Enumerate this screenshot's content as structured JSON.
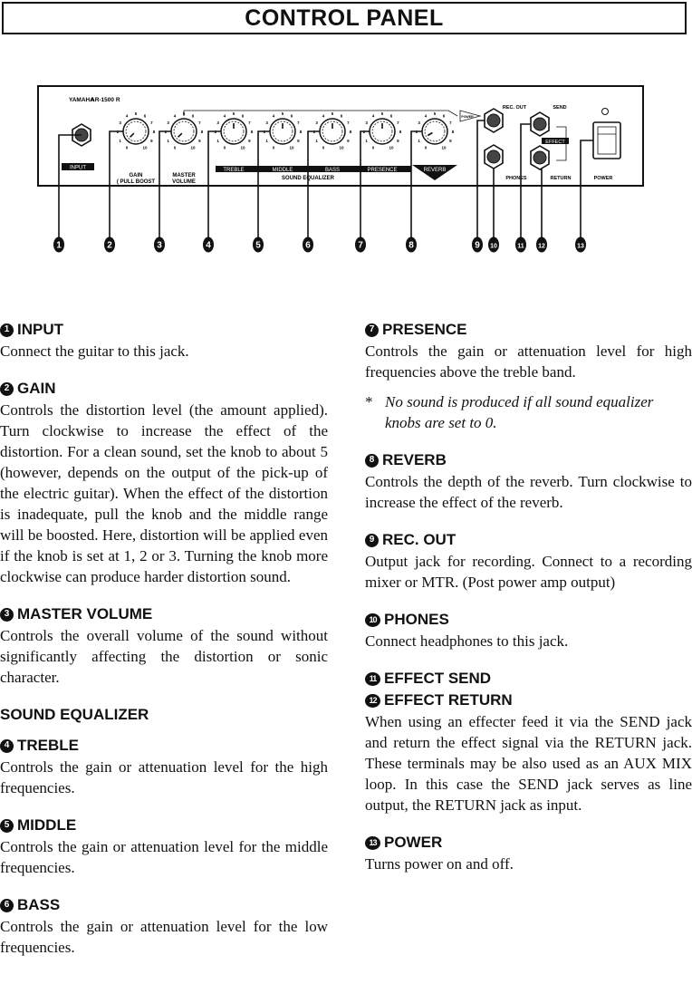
{
  "page": {
    "title": "CONTROL PANEL"
  },
  "panel": {
    "brand": "YAMAHA",
    "model": "AR-1500 R",
    "labels": {
      "input": "INPUT",
      "gain": "GAIN",
      "gain_sub": "( PULL BOOST",
      "master": "MASTER",
      "volume": "VOLUME",
      "treble": "TREBLE",
      "middle": "MIDDLE",
      "bass": "BASS",
      "presence": "PRESENCE",
      "reverb": "REVERB",
      "sound_equalizer": "SOUND EQUALIZER",
      "power_arrow": "POWER",
      "rec_out": "REC. OUT",
      "send": "SEND",
      "effect": "EFFECT",
      "phones": "PHONES",
      "return": "RETURN",
      "power": "POWER"
    },
    "knobs": [
      {
        "id": "gain",
        "value": 0.5
      },
      {
        "id": "master",
        "value": 0.5
      },
      {
        "id": "treble",
        "value": 5
      },
      {
        "id": "middle",
        "value": 5
      },
      {
        "id": "bass",
        "value": 5
      },
      {
        "id": "presence",
        "value": 5
      },
      {
        "id": "reverb",
        "value": 1
      }
    ],
    "scale": [
      "0",
      "1",
      "2",
      "3",
      "4",
      "5",
      "6",
      "7",
      "8",
      "9",
      "10"
    ],
    "callouts": [
      "1",
      "2",
      "3",
      "4",
      "5",
      "6",
      "7",
      "8",
      "9",
      "10",
      "11",
      "12",
      "13"
    ]
  },
  "left": {
    "input": {
      "num": "1",
      "title": "INPUT",
      "text": "Connect the guitar to this jack."
    },
    "gain": {
      "num": "2",
      "title": "GAIN",
      "text": "Controls the distortion level (the amount applied). Turn clockwise to increase the effect of the distortion. For a clean sound, set the knob to about 5 (however, depends on the output of the pick-up of the electric guitar). When the effect of the distortion is inadequate, pull the knob and the middle range will be boosted. Here, distortion will be applied even if the knob is set at 1, 2 or 3. Turning the knob more clockwise can produce harder distortion sound."
    },
    "master": {
      "num": "3",
      "title": "MASTER VOLUME",
      "text": "Controls the overall volume of the sound without significantly affecting the distortion or sonic character."
    },
    "eq_title": "SOUND EQUALIZER",
    "treble": {
      "num": "4",
      "title": "TREBLE",
      "text": "Controls the gain or attenuation level for the high frequencies."
    },
    "middle": {
      "num": "5",
      "title": "MIDDLE",
      "text": "Controls the gain or attenuation level for the middle frequencies."
    },
    "bass": {
      "num": "6",
      "title": "BASS",
      "text": "Controls the gain or attenuation level for the low frequencies."
    }
  },
  "right": {
    "presence": {
      "num": "7",
      "title": "PRESENCE",
      "text": "Controls the gain or attenuation level for high frequencies above the treble band.",
      "note_mark": "*",
      "note": "No sound is produced if all sound equalizer knobs are set to 0."
    },
    "reverb": {
      "num": "8",
      "title": "REVERB",
      "text": "Controls the depth of the reverb. Turn clockwise to increase the effect of the reverb."
    },
    "rec_out": {
      "num": "9",
      "title": "REC. OUT",
      "text": "Output jack for recording. Connect to a recording mixer or MTR. (Post power amp output)"
    },
    "phones": {
      "num": "10",
      "title": "PHONES",
      "text": "Connect headphones to this jack."
    },
    "effect_send": {
      "num": "11",
      "title": "EFFECT SEND"
    },
    "effect_return": {
      "num": "12",
      "title": "EFFECT RETURN",
      "text": "When using an effecter feed it via the SEND jack and return the effect signal via the RETURN jack. These terminals may be also used as an AUX MIX loop. In this case the SEND jack serves as line output, the RETURN jack as input."
    },
    "power": {
      "num": "13",
      "title": "POWER",
      "text": "Turns power on and off."
    }
  }
}
